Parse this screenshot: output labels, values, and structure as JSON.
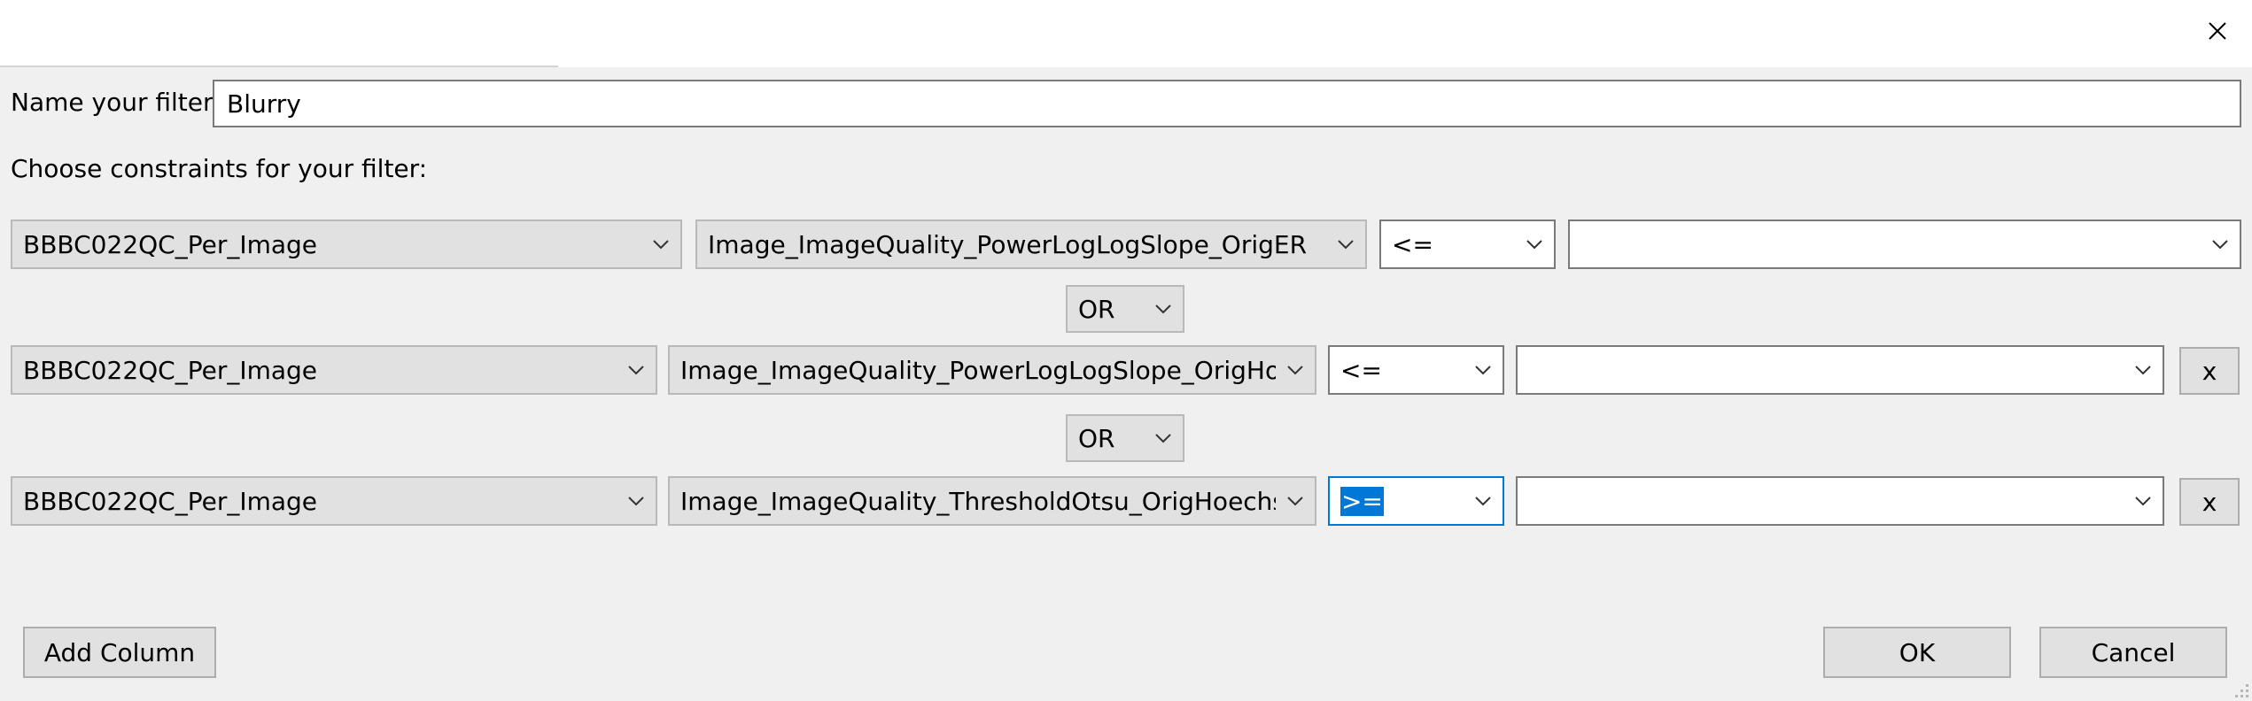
{
  "window": {
    "close_glyph": "✕"
  },
  "filter_name": {
    "label": "Name your filter:",
    "value": "Blurry"
  },
  "constraints_label": "Choose constraints for your filter:",
  "rows": [
    {
      "table": "BBBC022QC_Per_Image",
      "column": "Image_ImageQuality_PowerLogLogSlope_OrigER",
      "operator": "<=",
      "value": ""
    },
    {
      "table": "BBBC022QC_Per_Image",
      "column": "Image_ImageQuality_PowerLogLogSlope_OrigHoe",
      "operator": "<=",
      "value": "",
      "remove_label": "x"
    },
    {
      "table": "BBBC022QC_Per_Image",
      "column": "Image_ImageQuality_ThresholdOtsu_OrigHoechst_",
      "operator": ">=",
      "value": "",
      "remove_label": "x"
    }
  ],
  "connectors": [
    "OR",
    "OR"
  ],
  "buttons": {
    "add_column": "Add Column",
    "ok": "OK",
    "cancel": "Cancel"
  },
  "colors": {
    "focus": "#0078d7",
    "button_bg": "#e1e1e1",
    "dialog_bg": "#f0f0f0"
  }
}
